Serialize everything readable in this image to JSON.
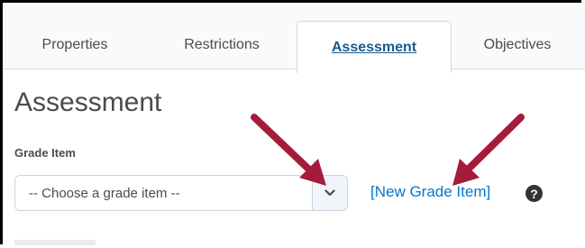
{
  "tabs": [
    {
      "label": "Properties",
      "active": false
    },
    {
      "label": "Restrictions",
      "active": false
    },
    {
      "label": "Assessment",
      "active": true
    },
    {
      "label": "Objectives",
      "active": false
    }
  ],
  "page": {
    "title": "Assessment"
  },
  "grade_item": {
    "label": "Grade Item",
    "selected_value": "-- Choose a grade item --",
    "new_link": "[New Grade Item]",
    "help_icon": "question-circle-icon"
  },
  "annotations": {
    "arrow_color": "#a51c3a"
  },
  "colors": {
    "link": "#0a74c7",
    "active_tab_text": "#1c5a8a",
    "text": "#494c4e"
  }
}
